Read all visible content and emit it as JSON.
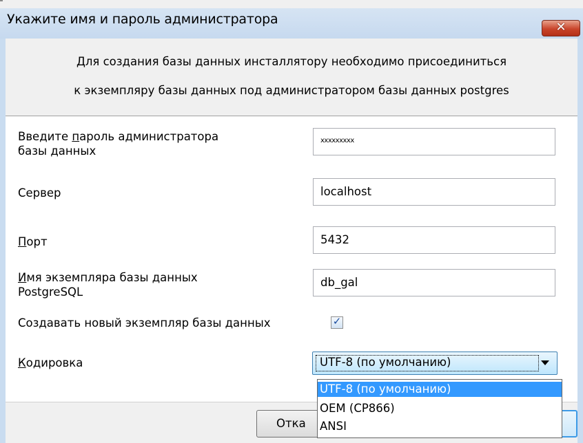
{
  "window": {
    "title": "Укажите имя и пароль администратора",
    "close_label": "✕"
  },
  "intro": {
    "line1": "Для создания базы данных инсталлятору необходимо присоединиться",
    "line2": "к экземпляру базы данных под администратором базы данных postgres"
  },
  "form": {
    "password": {
      "label_pre": "Введите ",
      "label_accel": "п",
      "label_post": "ароль администратора",
      "label_line2": "базы данных",
      "value": "xxxxxxxxx"
    },
    "server": {
      "label": "Сервер",
      "value": "localhost"
    },
    "port": {
      "label_accel": "П",
      "label_rest": "орт",
      "value": "5432"
    },
    "instance": {
      "label_accel": "И",
      "label_rest": "мя экземпляра базы данных",
      "label_line2": "PostgreSQL",
      "value": "db_gal"
    },
    "create_new": {
      "label": "Создавать новый экземпляр базы данных",
      "checked": true
    },
    "encoding": {
      "label_accel": "К",
      "label_rest": "одировка",
      "selected": "UTF-8 (по умолчанию)",
      "options": [
        "UTF-8 (по умолчанию)",
        "OEM (CP866)",
        "ANSI"
      ]
    }
  },
  "buttons": {
    "cancel_visible_text": "Отка"
  }
}
